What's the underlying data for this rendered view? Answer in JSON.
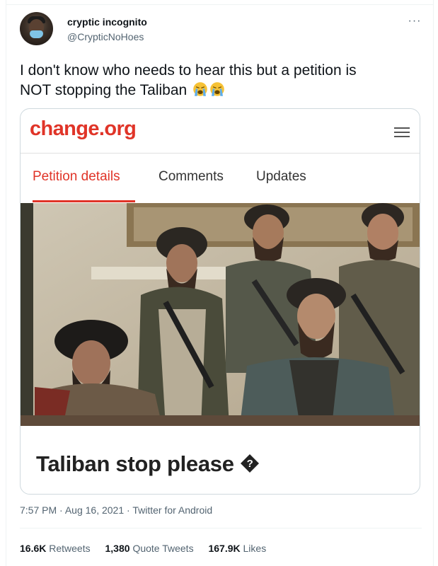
{
  "author": {
    "display_name": "cryptic incognito",
    "handle": "@CrypticNoHoes"
  },
  "tweet": {
    "text_line1": "I don't know who needs to hear this but a petition is",
    "text_line2": "NOT stopping the Taliban",
    "emojis": [
      "loudly-crying-face",
      "loudly-crying-face"
    ]
  },
  "media": {
    "brand": "change.org",
    "tabs": [
      {
        "label": "Petition details",
        "active": true
      },
      {
        "label": "Comments",
        "active": false
      },
      {
        "label": "Updates",
        "active": false
      }
    ],
    "petition_title": "Taliban stop please",
    "accent_color": "#e03428"
  },
  "meta": {
    "time": "7:57 PM",
    "date": "Aug 16, 2021",
    "source": "Twitter for Android"
  },
  "stats": {
    "retweets_count": "16.6K",
    "retweets_label": "Retweets",
    "quote_count": "1,380",
    "quote_label": "Quote Tweets",
    "likes_count": "167.9K",
    "likes_label": "Likes"
  }
}
